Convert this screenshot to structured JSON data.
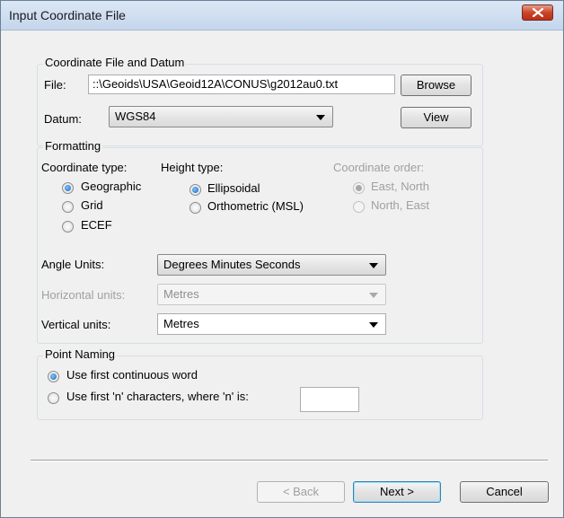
{
  "window": {
    "title": "Input Coordinate File",
    "close_icon": "close-x-icon"
  },
  "coord_file_group": {
    "legend": "Coordinate File and Datum",
    "file_label": "File:",
    "file_value": "::\\Geoids\\USA\\Geoid12A\\CONUS\\g2012au0.txt",
    "browse_label": "Browse",
    "datum_label": "Datum:",
    "datum_value": "WGS84",
    "view_label": "View"
  },
  "formatting": {
    "legend": "Formatting",
    "coord_type_label": "Coordinate type:",
    "coord_types": [
      {
        "label": "Geographic",
        "selected": true
      },
      {
        "label": "Grid",
        "selected": false
      },
      {
        "label": "ECEF",
        "selected": false
      }
    ],
    "height_type_label": "Height type:",
    "height_types": [
      {
        "label": "Ellipsoidal",
        "selected": true
      },
      {
        "label": "Orthometric (MSL)",
        "selected": false
      }
    ],
    "coord_order_label": "Coordinate order:",
    "coord_orders": [
      {
        "label": "East, North",
        "selected": true
      },
      {
        "label": "North, East",
        "selected": false
      }
    ],
    "angle_units_label": "Angle Units:",
    "angle_units_value": "Degrees Minutes Seconds",
    "horizontal_units_label": "Horizontal units:",
    "horizontal_units_value": "Metres",
    "vertical_units_label": "Vertical units:",
    "vertical_units_value": "Metres"
  },
  "point_naming": {
    "legend": "Point Naming",
    "options": [
      {
        "label": "Use first continuous word",
        "selected": true
      },
      {
        "label": "Use first 'n' characters, where 'n' is:",
        "selected": false
      }
    ],
    "n_value": ""
  },
  "footer": {
    "back_label": "< Back",
    "next_label": "Next >",
    "cancel_label": "Cancel"
  }
}
